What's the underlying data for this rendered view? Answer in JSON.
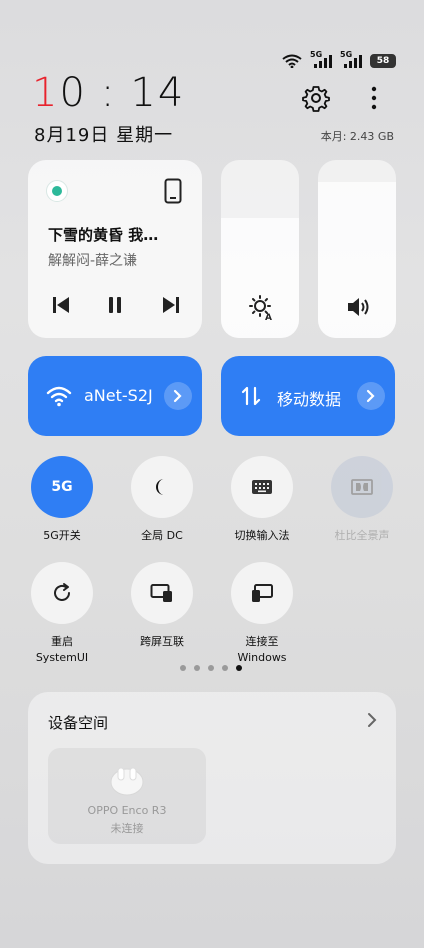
{
  "status_bar": {
    "wifi": "wifi-icon",
    "sim1": "5G",
    "sim2": "5G",
    "battery": "58"
  },
  "clock": {
    "hour_first": "1",
    "hour_rest": "0",
    "sep": ":",
    "minutes": "14"
  },
  "date": "8月19日 星期一",
  "usage": "本月: 2.43 GB",
  "music": {
    "title": "下雪的黄昏 我…",
    "artist": "解解闷-薛之谦"
  },
  "wifi_tile": {
    "label": "aNet-S2J"
  },
  "mobile_tile": {
    "label": "移动数据"
  },
  "tiles_row1": [
    {
      "label": "5G开关",
      "icon": "5G",
      "active": true
    },
    {
      "label": "全局 DC",
      "icon": "moon-icon",
      "active": false
    },
    {
      "label": "切换输入法",
      "icon": "keyboard-icon",
      "active": false
    },
    {
      "label": "杜比全景声",
      "icon": "dolby-icon",
      "active": false,
      "disabled": true
    }
  ],
  "tiles_row2": [
    {
      "label_l1": "重启",
      "label_l2": "SystemUI",
      "icon": "restart-icon"
    },
    {
      "label_l1": "跨屏互联",
      "label_l2": "",
      "icon": "screen-connect-icon"
    },
    {
      "label_l1": "连接至",
      "label_l2": "Windows",
      "icon": "windows-connect-icon"
    }
  ],
  "pager": {
    "count": 5,
    "active_index": 4
  },
  "device_space": {
    "title": "设备空间",
    "device_name": "OPPO Enco R3",
    "device_status": "未连接"
  },
  "colors": {
    "accent": "#2f7ef4",
    "clock_red": "#e8222d"
  }
}
